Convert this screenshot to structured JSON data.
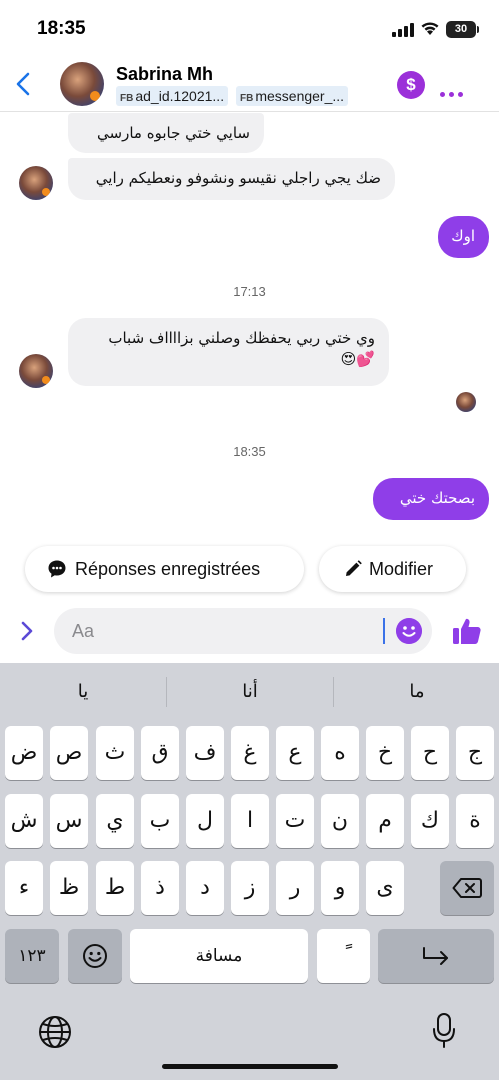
{
  "status_bar": {
    "time": "18:35",
    "battery": "30"
  },
  "header": {
    "contact_name": "Sabrina Mh",
    "tag1_prefix": "FB",
    "tag1": "ad_id.12021...",
    "tag2_prefix": "FB",
    "tag2": "messenger_...",
    "dollar_label": "$"
  },
  "messages": [
    {
      "side": "in",
      "text": "سايي ختي جابوه مارسي"
    },
    {
      "side": "in",
      "text": "ضك يجي راجلي نقيسو ونشوفو ونعطيكم رايي"
    },
    {
      "side": "out",
      "text": "اوك"
    },
    {
      "side": "time",
      "text": "17:13"
    },
    {
      "side": "in",
      "text": "وي ختي ربي يحفظك وصلني بزااااف شباب",
      "emoji": "💕😍"
    },
    {
      "side": "time",
      "text": "18:35"
    },
    {
      "side": "out",
      "text": "بصحتك ختي"
    }
  ],
  "quick_actions": {
    "saved_replies": "Réponses enregistrées",
    "edit": "Modifier"
  },
  "composer": {
    "placeholder": "Aa"
  },
  "keyboard": {
    "suggestions": [
      "يا",
      "أنا",
      "ما"
    ],
    "row1": [
      "ض",
      "ص",
      "ث",
      "ق",
      "ف",
      "غ",
      "ع",
      "ه",
      "خ",
      "ح",
      "ج"
    ],
    "row2": [
      "ش",
      "س",
      "ي",
      "ب",
      "ل",
      "ا",
      "ت",
      "ن",
      "م",
      "ك",
      "ة"
    ],
    "row3": [
      "ء",
      "ظ",
      "ط",
      "ذ",
      "د",
      "ز",
      "ر",
      "و",
      "ى"
    ],
    "numbers_key": "١٢٣",
    "space_key": "مسافة",
    "diacritic_key": "ً"
  },
  "colors": {
    "accent": "#8f3ee8",
    "link": "#1a73e8"
  }
}
